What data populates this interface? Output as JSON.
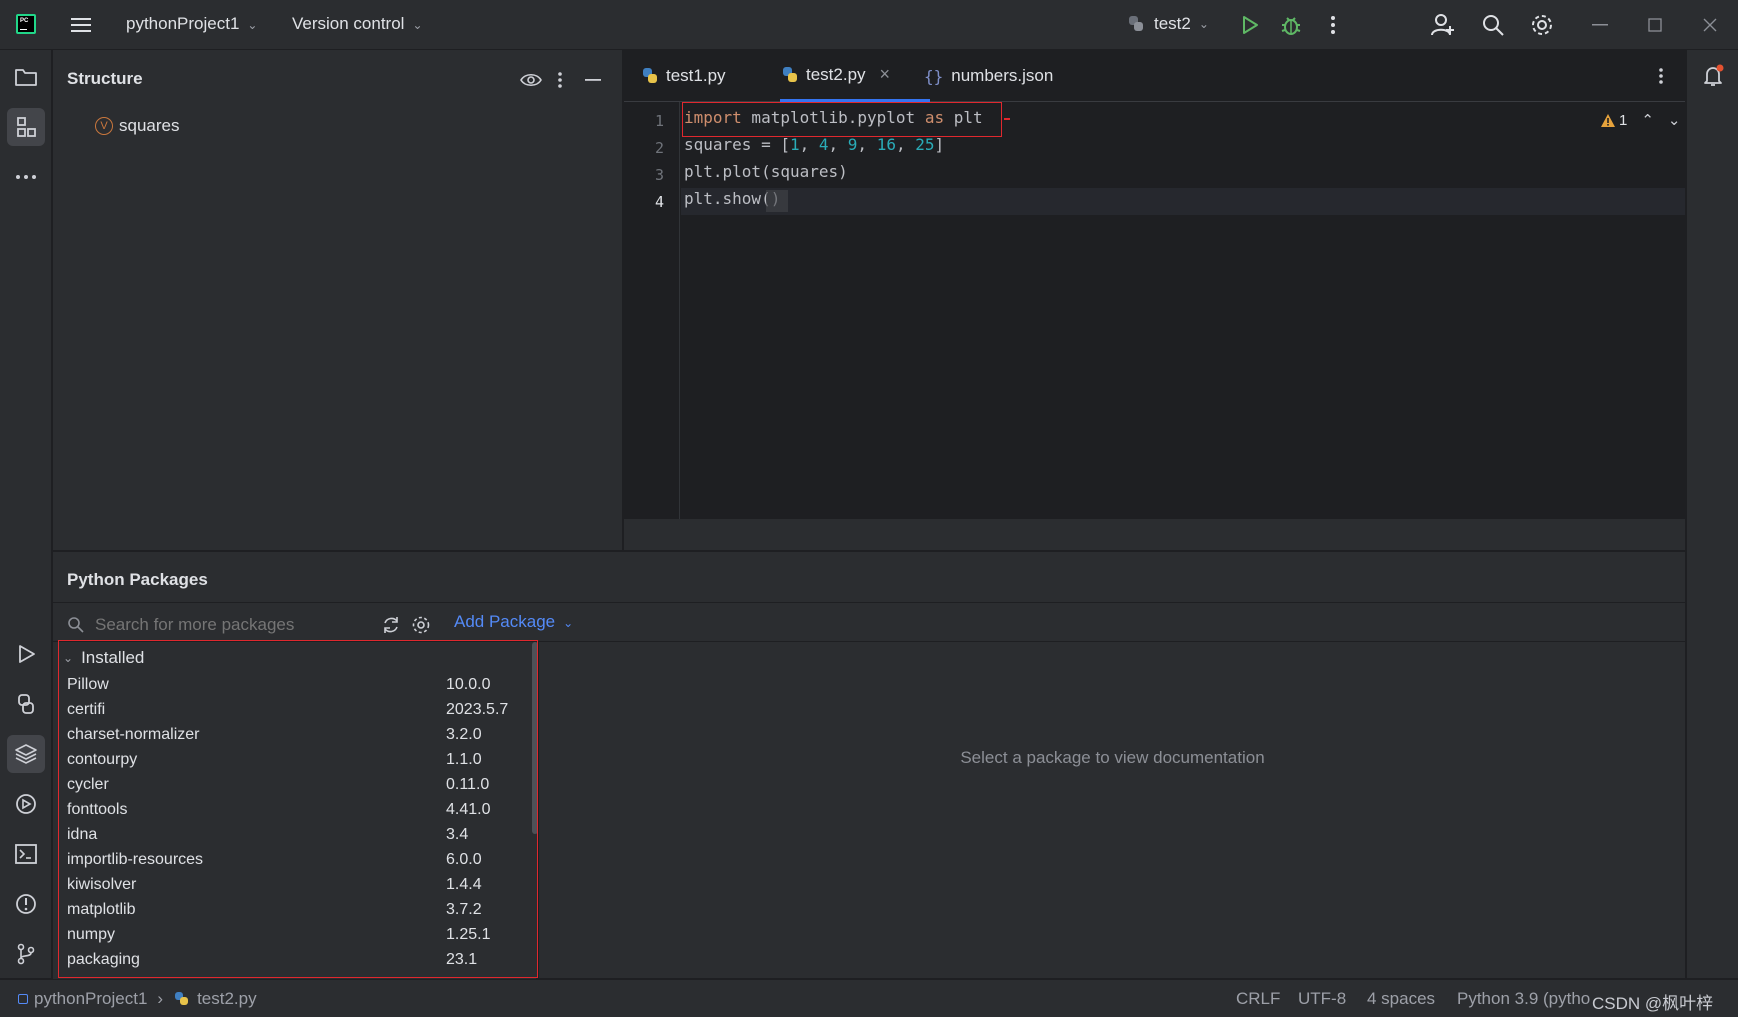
{
  "titlebar": {
    "project": "pythonProject1",
    "vcs": "Version control",
    "run_config": "test2"
  },
  "structure": {
    "title": "Structure",
    "items": [
      {
        "badge": "V",
        "label": "squares"
      }
    ]
  },
  "editor": {
    "tabs": [
      {
        "label": "test1.py",
        "icon": "python-file-icon"
      },
      {
        "label": "test2.py",
        "icon": "python-file-icon",
        "active": true
      },
      {
        "label": "numbers.json",
        "icon": "json-file-icon"
      }
    ],
    "tab_close": "×",
    "line_numbers": [
      "1",
      "2",
      "3",
      "4"
    ],
    "lines": [
      [
        {
          "t": "import",
          "c": "kw"
        },
        {
          "t": " matplotlib.pyplot ",
          "c": ""
        },
        {
          "t": "as",
          "c": "kw"
        },
        {
          "t": " plt",
          "c": ""
        }
      ],
      [
        {
          "t": "squares = [",
          "c": ""
        },
        {
          "t": "1",
          "c": "num"
        },
        {
          "t": ", ",
          "c": ""
        },
        {
          "t": "4",
          "c": "num"
        },
        {
          "t": ", ",
          "c": ""
        },
        {
          "t": "9",
          "c": "num"
        },
        {
          "t": ", ",
          "c": ""
        },
        {
          "t": "16",
          "c": "num"
        },
        {
          "t": ", ",
          "c": ""
        },
        {
          "t": "25",
          "c": "num"
        },
        {
          "t": "]",
          "c": ""
        }
      ],
      [
        {
          "t": "plt.plot(squares)",
          "c": ""
        }
      ],
      [
        {
          "t": "plt.show()",
          "c": ""
        }
      ]
    ],
    "warnings_count": "1"
  },
  "packages": {
    "title": "Python Packages",
    "search_placeholder": "Search for more packages",
    "add_package": "Add Package",
    "installed_label": "Installed",
    "installed": [
      {
        "name": "Pillow",
        "version": "10.0.0"
      },
      {
        "name": "certifi",
        "version": "2023.5.7"
      },
      {
        "name": "charset-normalizer",
        "version": "3.2.0"
      },
      {
        "name": "contourpy",
        "version": "1.1.0"
      },
      {
        "name": "cycler",
        "version": "0.11.0"
      },
      {
        "name": "fonttools",
        "version": "4.41.0"
      },
      {
        "name": "idna",
        "version": "3.4"
      },
      {
        "name": "importlib-resources",
        "version": "6.0.0"
      },
      {
        "name": "kiwisolver",
        "version": "1.4.4"
      },
      {
        "name": "matplotlib",
        "version": "3.7.2"
      },
      {
        "name": "numpy",
        "version": "1.25.1"
      },
      {
        "name": "packaging",
        "version": "23.1"
      }
    ],
    "doc_placeholder": "Select a package to view documentation"
  },
  "statusbar": {
    "breadcrumb_project": "pythonProject1",
    "breadcrumb_file": "test2.py",
    "line_ending": "CRLF",
    "encoding": "UTF-8",
    "indent": "4 spaces",
    "interpreter": "Python 3.9 (pytho",
    "watermark": "CSDN @枫叶梓"
  },
  "colors": {
    "accent_blue": "#3574f0",
    "highlight_red": "#e0282e",
    "run_green": "#5fb865",
    "notification_red": "#e55230"
  }
}
